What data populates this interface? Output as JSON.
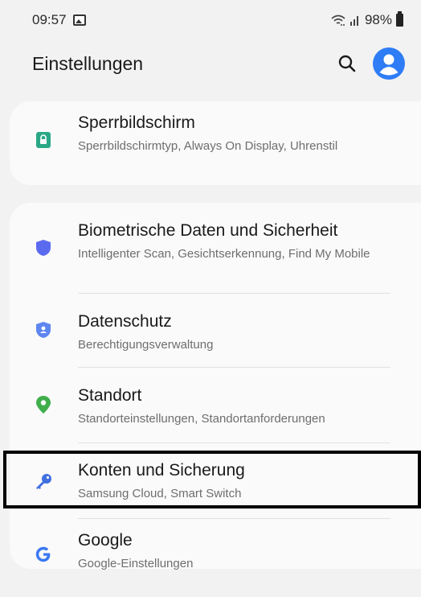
{
  "status_bar": {
    "time": "09:57",
    "battery": "98%"
  },
  "header": {
    "title": "Einstellungen"
  },
  "groups": [
    {
      "items": [
        {
          "title": "Sperrbildschirm",
          "subtitle": "Sperrbildschirmtyp, Always On Display, Uhrenstil",
          "icon": "lock-icon",
          "icon_color": "#2aa886"
        }
      ]
    },
    {
      "items": [
        {
          "title": "Biometrische Daten und Sicherheit",
          "subtitle": "Intelligenter Scan, Gesichtserkennung, Find My Mobile",
          "icon": "shield-icon",
          "icon_color": "#5b6bef"
        },
        {
          "title": "Datenschutz",
          "subtitle": "Berechtigungsverwaltung",
          "icon": "privacy-shield-icon",
          "icon_color": "#5f86f0"
        },
        {
          "title": "Standort",
          "subtitle": "Standorteinstellungen, Standortanforderungen",
          "icon": "location-pin-icon",
          "icon_color": "#3fae4b"
        },
        {
          "title": "Konten und Sicherung",
          "subtitle": "Samsung Cloud, Smart Switch",
          "icon": "key-icon",
          "icon_color": "#3f6fe0"
        },
        {
          "title": "Google",
          "subtitle": "Google-Einstellungen",
          "icon": "google-icon",
          "icon_color": "#3a78f2"
        }
      ]
    }
  ]
}
